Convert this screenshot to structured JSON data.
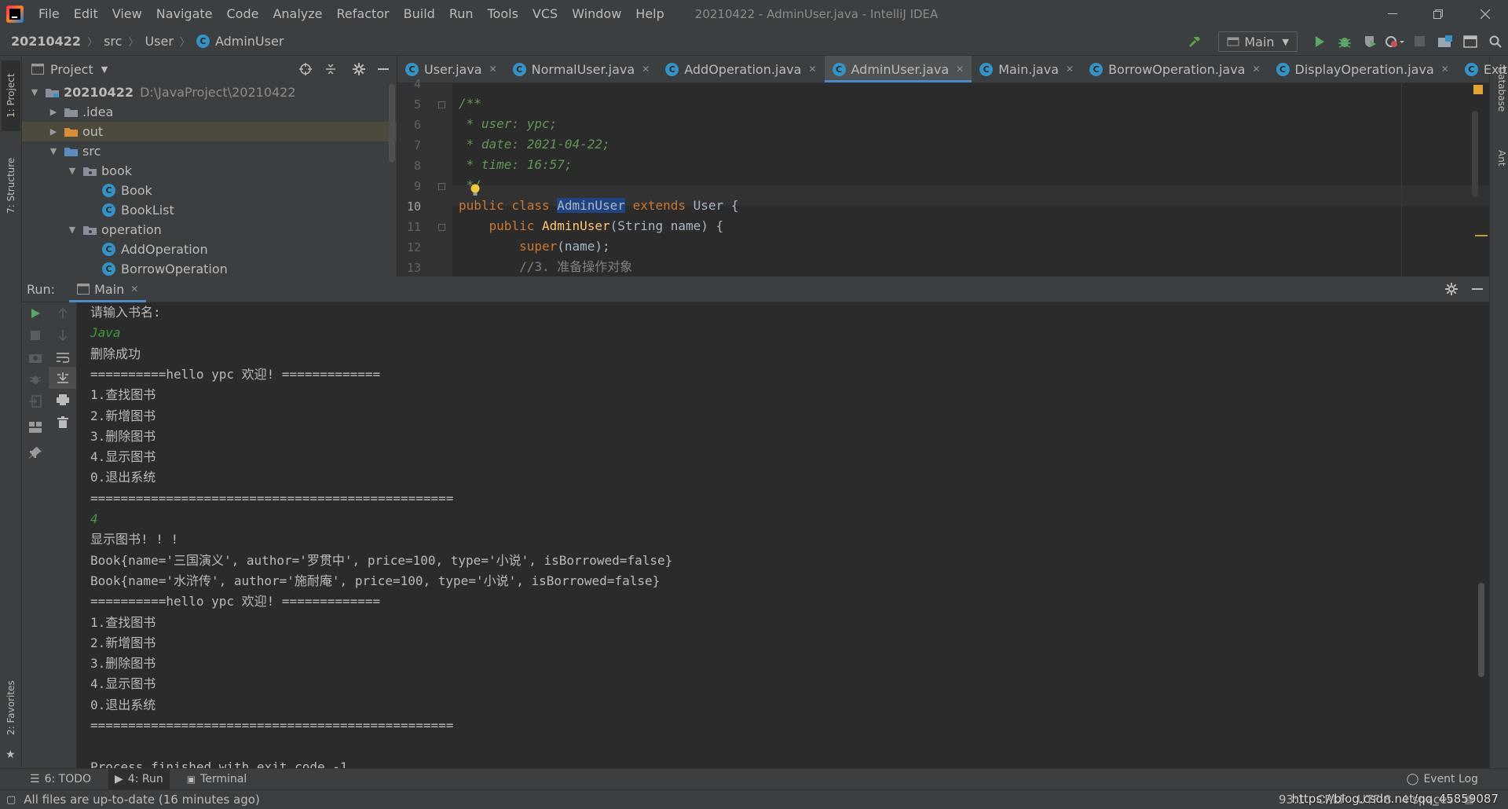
{
  "window": {
    "title": "20210422 - AdminUser.java - IntelliJ IDEA",
    "menu": [
      "File",
      "Edit",
      "View",
      "Navigate",
      "Code",
      "Analyze",
      "Refactor",
      "Build",
      "Run",
      "Tools",
      "VCS",
      "Window",
      "Help"
    ]
  },
  "navbar": {
    "breadcrumb": [
      "20210422",
      "src",
      "User",
      "AdminUser"
    ],
    "run_config": "Main"
  },
  "left_strip": {
    "project_tab": "1: Project",
    "structure_tab": "7: Structure",
    "favorites_tab": "2: Favorites"
  },
  "right_strip": {
    "database_tab": "Database",
    "ant_tab": "Ant"
  },
  "project_panel": {
    "title": "Project",
    "tree": [
      {
        "label": "20210422",
        "path": "D:\\JavaProject\\20210422",
        "type": "module",
        "depth": 0,
        "expanded": true
      },
      {
        "label": ".idea",
        "type": "folder",
        "depth": 1,
        "expanded": false
      },
      {
        "label": "out",
        "type": "folder-orange",
        "depth": 1,
        "expanded": false,
        "selected": true
      },
      {
        "label": "src",
        "type": "folder-blue",
        "depth": 1,
        "expanded": true
      },
      {
        "label": "book",
        "type": "package",
        "depth": 2,
        "expanded": true
      },
      {
        "label": "Book",
        "type": "class",
        "depth": 3
      },
      {
        "label": "BookList",
        "type": "class",
        "depth": 3
      },
      {
        "label": "operation",
        "type": "package",
        "depth": 2,
        "expanded": true
      },
      {
        "label": "AddOperation",
        "type": "class",
        "depth": 3
      },
      {
        "label": "BorrowOperation",
        "type": "class",
        "depth": 3
      }
    ]
  },
  "editor": {
    "tabs": [
      {
        "label": "User.java",
        "active": false
      },
      {
        "label": "NormalUser.java",
        "active": false
      },
      {
        "label": "AddOperation.java",
        "active": false
      },
      {
        "label": "AdminUser.java",
        "active": true
      },
      {
        "label": "Main.java",
        "active": false
      },
      {
        "label": "BorrowOperation.java",
        "active": false
      },
      {
        "label": "DisplayOperation.java",
        "active": false
      },
      {
        "label": "ExitOpe",
        "active": false
      }
    ],
    "line_numbers": [
      "4",
      "5",
      "6",
      "7",
      "8",
      "9",
      "10",
      "11",
      "12",
      "13"
    ],
    "current_line": "10",
    "code": {
      "l5": "/**",
      "l6": " * user: ypc;",
      "l7": " * date: 2021-04-22;",
      "l8": " * time: 16:57;",
      "l9": " */",
      "l10_kw": "public class ",
      "l10_cls": "AdminUser",
      "l10_ext": " extends ",
      "l10_rest": "User {",
      "l11_kw": "    public ",
      "l11_fn": "AdminUser",
      "l11_rest": "(String name) {",
      "l12_kw": "        super",
      "l12_rest": "(name);",
      "l13": "        //3. 准备操作对象"
    }
  },
  "run_panel": {
    "label": "Run:",
    "tab": "Main",
    "console": [
      {
        "text": "请输入书名:",
        "input": false
      },
      {
        "text": "Java",
        "input": true
      },
      {
        "text": "删除成功",
        "input": false
      },
      {
        "text": "==========hello ypc 欢迎! =============",
        "input": false
      },
      {
        "text": "1.查找图书",
        "input": false
      },
      {
        "text": "2.新增图书",
        "input": false
      },
      {
        "text": "3.删除图书",
        "input": false
      },
      {
        "text": "4.显示图书",
        "input": false
      },
      {
        "text": "0.退出系统",
        "input": false
      },
      {
        "text": "================================================",
        "input": false
      },
      {
        "text": "4",
        "input": true
      },
      {
        "text": "显示图书! ! !",
        "input": false
      },
      {
        "text": "Book{name='三国演义', author='罗贯中', price=100, type='小说', isBorrowed=false}",
        "input": false
      },
      {
        "text": "Book{name='水浒传', author='施耐庵', price=100, type='小说', isBorrowed=false}",
        "input": false
      },
      {
        "text": "==========hello ypc 欢迎! =============",
        "input": false
      },
      {
        "text": "1.查找图书",
        "input": false
      },
      {
        "text": "2.新增图书",
        "input": false
      },
      {
        "text": "3.删除图书",
        "input": false
      },
      {
        "text": "4.显示图书",
        "input": false
      },
      {
        "text": "0.退出系统",
        "input": false
      },
      {
        "text": "================================================",
        "input": false
      },
      {
        "text": "",
        "input": false
      },
      {
        "text": "Process finished with exit code -1",
        "input": false
      }
    ]
  },
  "bottom_tabs": {
    "todo": "6: TODO",
    "run": "4: Run",
    "terminal": "Terminal",
    "event_log": "Event Log"
  },
  "status": {
    "message": "All files are up-to-date (16 minutes ago)",
    "position": "93:1",
    "line_sep": "CRLF",
    "encoding": "UTF-8",
    "indent": "4 spaces",
    "watermark": "https://blog.csdn.net/qq_45859087"
  },
  "colors": {
    "accent": "#4a88c7",
    "bg": "#2b2b2b",
    "panel": "#3c3f41",
    "keyword": "#cc7832",
    "comment": "#629755",
    "console_input": "#3c9a3c"
  }
}
